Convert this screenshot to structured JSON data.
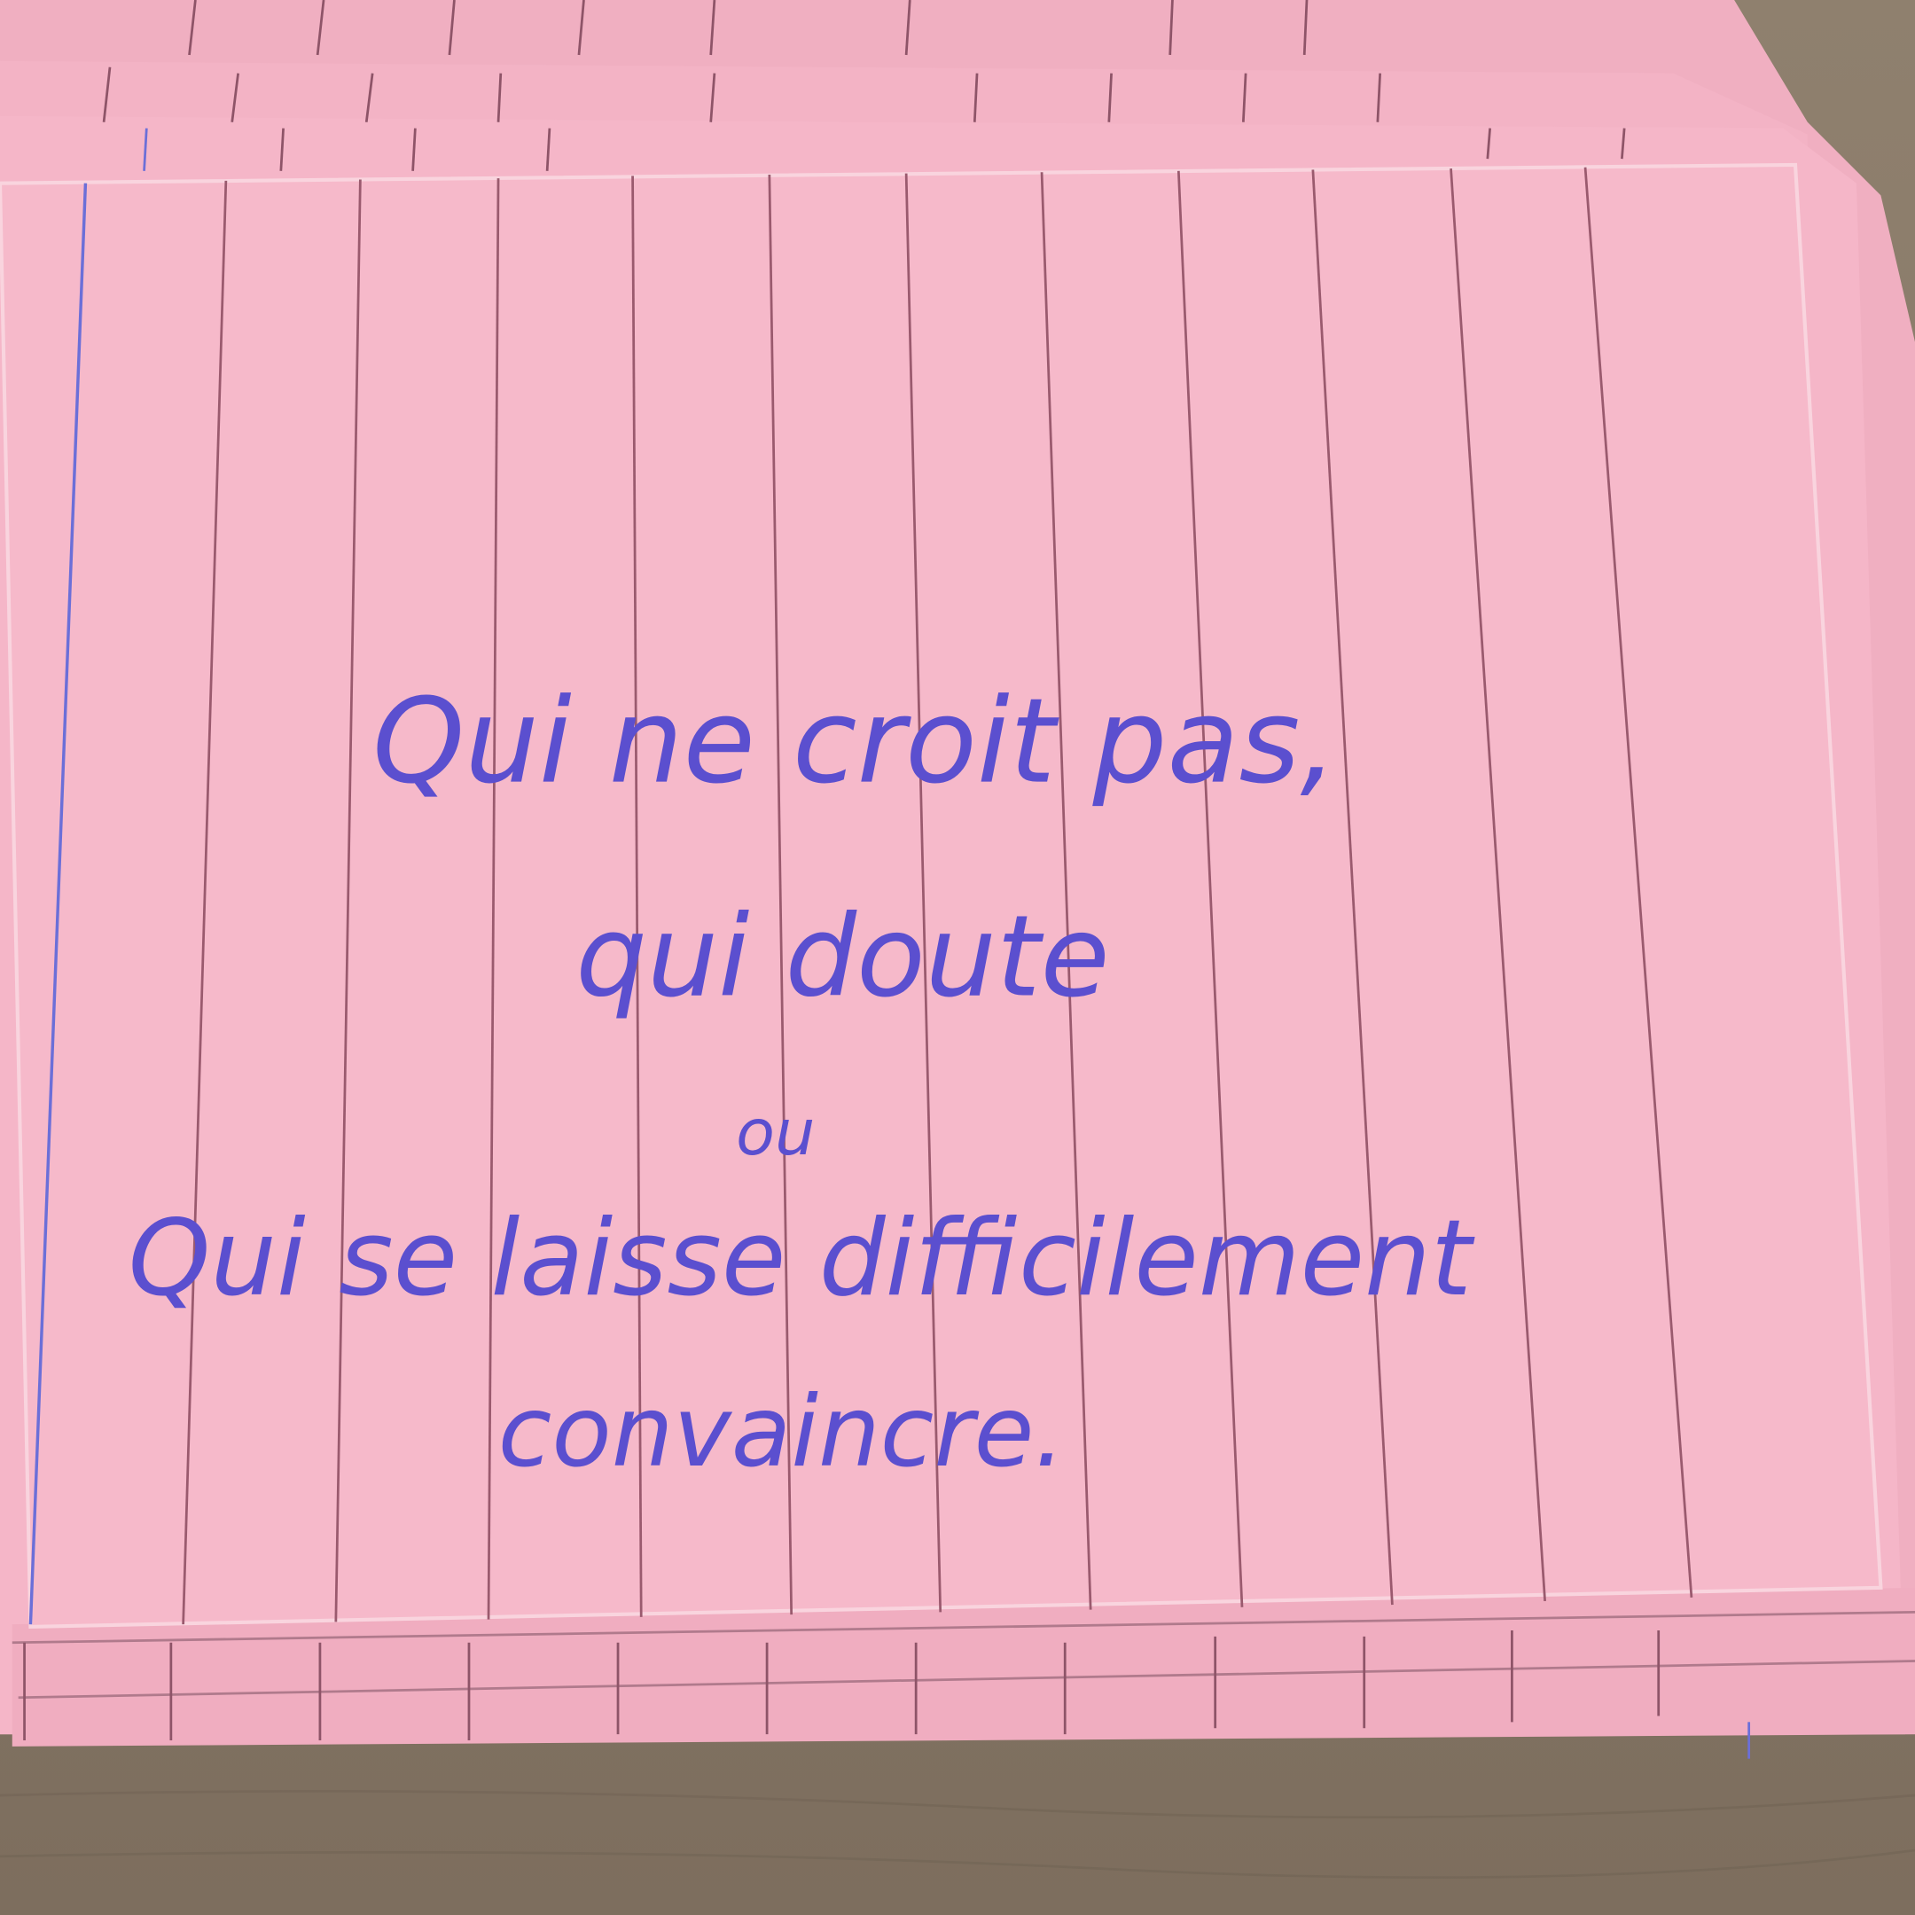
{
  "card": {
    "colors": {
      "paper": "#f4b4c6",
      "rule": "#9a5a6e",
      "margin": "#6b6fd8",
      "ink": "#5b4fcf",
      "wood": "#8c7d6c"
    },
    "handwriting": {
      "line1": "Qui ne croit pas,",
      "line2": "qui doute",
      "line3": "ou",
      "line4": "Qui se laisse difficilement",
      "line5": "convaincre."
    }
  }
}
